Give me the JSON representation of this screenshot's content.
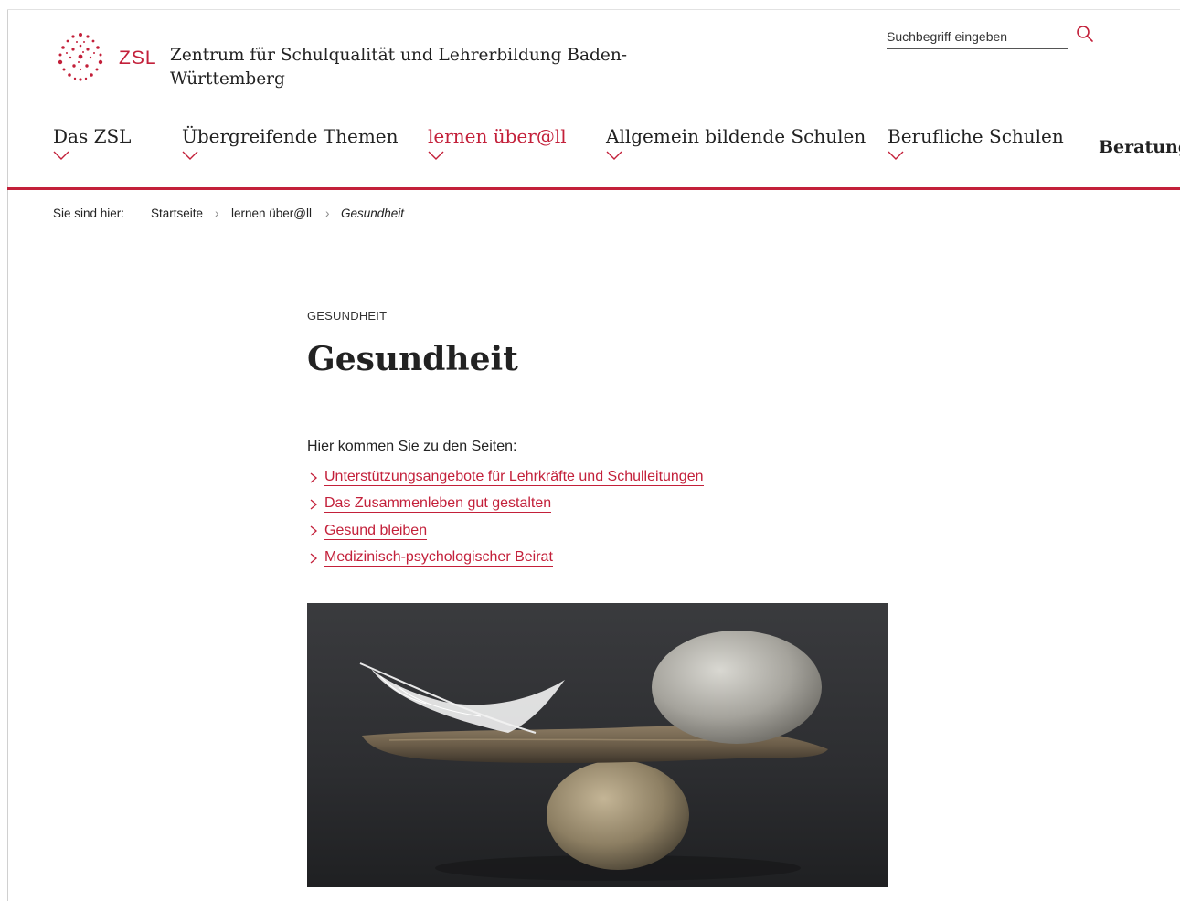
{
  "header": {
    "logo_text": "ZSL",
    "org_name": "Zentrum für Schulqualität und Lehrerbildung Baden-Württemberg",
    "search_placeholder": "Suchbegriff eingeben"
  },
  "nav": {
    "items": [
      {
        "label": "Das ZSL"
      },
      {
        "label": "Übergreifende Themen"
      },
      {
        "label": "lernen über@ll"
      },
      {
        "label": "Allgemein bildende Schulen"
      },
      {
        "label": "Berufliche Schulen"
      },
      {
        "label": "Beratung"
      }
    ]
  },
  "breadcrumb": {
    "prefix": "Sie sind hier:",
    "items": [
      "Startseite",
      "lernen über@ll",
      "Gesundheit"
    ],
    "separator": "›"
  },
  "main": {
    "kicker": "GESUNDHEIT",
    "title": "Gesundheit",
    "intro": "Hier kommen Sie zu den Seiten:",
    "links": [
      "Unterstützungsangebote für Lehrkräfte und Schulleitungen",
      "Das Zusammenleben gut gestalten",
      "Gesund bleiben",
      "Medizinisch-psychologischer Beirat"
    ]
  },
  "colors": {
    "accent": "#c3203a",
    "text": "#222222"
  }
}
